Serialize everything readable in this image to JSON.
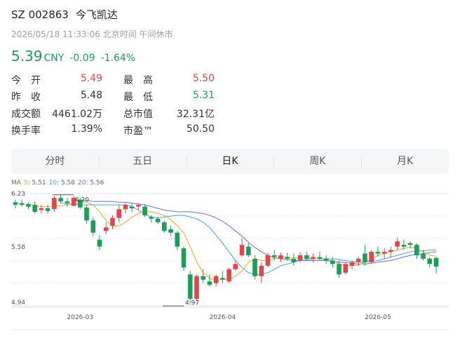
{
  "header": {
    "code": "SZ 002863",
    "name": "今飞凯达",
    "timestamp": "2026/05/18 11:33:06",
    "timezone": "北京时间",
    "status": "午间休市"
  },
  "quote": {
    "price": "5.39",
    "currency": "CNY",
    "change": "-0.09",
    "change_pct": "-1.64%"
  },
  "stats": [
    {
      "label": "今　开",
      "value": "5.49",
      "tone": "up"
    },
    {
      "label": "最　高",
      "value": "5.50",
      "tone": "up"
    },
    {
      "label": "昨　收",
      "value": "5.48",
      "tone": "neutral"
    },
    {
      "label": "最　低",
      "value": "5.31",
      "tone": "down"
    },
    {
      "label": "成交额",
      "value": "4461.02万",
      "tone": "neutral"
    },
    {
      "label": "总市值",
      "value": "32.31亿",
      "tone": "neutral"
    },
    {
      "label": "换手率",
      "value": "1.39%",
      "tone": "neutral"
    },
    {
      "label": "市盈™",
      "value": "50.50",
      "tone": "neutral"
    }
  ],
  "tabs": [
    {
      "label": "分时",
      "active": false
    },
    {
      "label": "五日",
      "active": false
    },
    {
      "label": "日K",
      "active": true
    },
    {
      "label": "周K",
      "active": false
    },
    {
      "label": "月K",
      "active": false
    }
  ],
  "colors": {
    "up": "#e0474c",
    "down": "#1a9f5a",
    "ma5": "#f5a623",
    "ma10": "#4aa3df",
    "ma20": "#6a6fd8"
  },
  "chart_data": {
    "type": "candlestick",
    "ma_legend": [
      {
        "name": "MA",
        "value": ""
      },
      {
        "name": "5",
        "value": "5.51"
      },
      {
        "name": "10",
        "value": "5.58"
      },
      {
        "name": "20",
        "value": "5.56"
      }
    ],
    "y_ticks": [
      "6.23",
      "5.58",
      "4.94"
    ],
    "ylim": [
      4.94,
      6.23
    ],
    "x_ticks": [
      {
        "label": "2026-03",
        "index": 10
      },
      {
        "label": "2026-04",
        "index": 32
      },
      {
        "label": "2026-05",
        "index": 56
      }
    ],
    "annotations": [
      {
        "label": "6.20",
        "index": 9,
        "value": 6.2
      },
      {
        "label": "4.97",
        "index": 26,
        "value": 4.97
      }
    ],
    "candles": [
      [
        6.13,
        6.16,
        6.06,
        6.1
      ],
      [
        6.12,
        6.16,
        6.08,
        6.1
      ],
      [
        6.11,
        6.13,
        6.05,
        6.08
      ],
      [
        6.1,
        6.14,
        6.0,
        6.02
      ],
      [
        6.04,
        6.1,
        6.0,
        6.06
      ],
      [
        6.06,
        6.1,
        6.0,
        6.03
      ],
      [
        6.05,
        6.2,
        6.02,
        6.18
      ],
      [
        6.18,
        6.22,
        6.12,
        6.14
      ],
      [
        6.14,
        6.18,
        6.08,
        6.12
      ],
      [
        6.09,
        6.2,
        6.08,
        6.18
      ],
      [
        6.16,
        6.18,
        6.05,
        6.07
      ],
      [
        6.07,
        6.1,
        5.88,
        5.92
      ],
      [
        5.92,
        5.96,
        5.74,
        5.78
      ],
      [
        5.7,
        5.75,
        5.58,
        5.62
      ],
      [
        5.8,
        5.9,
        5.76,
        5.84
      ],
      [
        5.86,
        5.98,
        5.82,
        5.95
      ],
      [
        5.95,
        6.1,
        5.9,
        6.05
      ],
      [
        6.05,
        6.12,
        6.0,
        6.1
      ],
      [
        6.08,
        6.12,
        6.02,
        6.06
      ],
      [
        6.08,
        6.12,
        6.04,
        6.1
      ],
      [
        6.08,
        6.1,
        5.96,
        5.98
      ],
      [
        5.96,
        5.98,
        5.9,
        5.94
      ],
      [
        5.94,
        5.96,
        5.88,
        5.9
      ],
      [
        5.9,
        5.92,
        5.78,
        5.8
      ],
      [
        5.82,
        5.86,
        5.74,
        5.78
      ],
      [
        5.78,
        5.8,
        5.58,
        5.62
      ],
      [
        5.6,
        5.62,
        5.34,
        5.38
      ],
      [
        5.3,
        5.34,
        4.97,
        5.02
      ],
      [
        5.02,
        5.3,
        5.0,
        5.28
      ],
      [
        5.28,
        5.36,
        5.2,
        5.24
      ],
      [
        5.22,
        5.3,
        5.16,
        5.18
      ],
      [
        5.2,
        5.3,
        5.16,
        5.28
      ],
      [
        5.26,
        5.34,
        5.2,
        5.24
      ],
      [
        5.22,
        5.38,
        5.2,
        5.36
      ],
      [
        5.36,
        5.46,
        5.34,
        5.42
      ],
      [
        5.52,
        5.72,
        5.5,
        5.64
      ],
      [
        5.62,
        5.66,
        5.5,
        5.52
      ],
      [
        5.48,
        5.52,
        5.24,
        5.28
      ],
      [
        5.28,
        5.44,
        5.2,
        5.4
      ],
      [
        5.4,
        5.55,
        5.38,
        5.52
      ],
      [
        5.52,
        5.58,
        5.46,
        5.5
      ],
      [
        5.48,
        5.55,
        5.44,
        5.52
      ],
      [
        5.5,
        5.55,
        5.46,
        5.48
      ],
      [
        5.48,
        5.54,
        5.4,
        5.44
      ],
      [
        5.46,
        5.56,
        5.44,
        5.52
      ],
      [
        5.52,
        5.56,
        5.46,
        5.48
      ],
      [
        5.48,
        5.54,
        5.44,
        5.5
      ],
      [
        5.5,
        5.56,
        5.46,
        5.48
      ],
      [
        5.48,
        5.52,
        5.42,
        5.46
      ],
      [
        5.46,
        5.5,
        5.38,
        5.42
      ],
      [
        5.42,
        5.46,
        5.26,
        5.3
      ],
      [
        5.32,
        5.44,
        5.3,
        5.42
      ],
      [
        5.4,
        5.46,
        5.36,
        5.44
      ],
      [
        5.44,
        5.5,
        5.4,
        5.48
      ],
      [
        5.54,
        5.64,
        5.4,
        5.44
      ],
      [
        5.44,
        5.58,
        5.42,
        5.56
      ],
      [
        5.56,
        5.62,
        5.5,
        5.54
      ],
      [
        5.54,
        5.6,
        5.48,
        5.56
      ],
      [
        5.56,
        5.62,
        5.5,
        5.58
      ],
      [
        5.62,
        5.72,
        5.58,
        5.68
      ],
      [
        5.64,
        5.7,
        5.58,
        5.62
      ],
      [
        5.66,
        5.68,
        5.6,
        5.64
      ],
      [
        5.64,
        5.66,
        5.48,
        5.52
      ],
      [
        5.54,
        5.58,
        5.46,
        5.48
      ],
      [
        5.48,
        5.5,
        5.38,
        5.42
      ],
      [
        5.49,
        5.5,
        5.31,
        5.39
      ]
    ],
    "ma5": [
      6.1,
      6.09,
      6.08,
      6.08,
      6.08,
      6.09,
      6.1,
      6.11,
      6.12,
      6.13,
      6.1,
      6.02,
      5.92,
      5.85,
      5.86,
      5.9,
      5.96,
      6.0,
      6.03,
      6.02,
      6.0,
      5.98,
      5.93,
      5.86,
      5.78,
      5.62,
      5.44,
      5.32,
      5.26,
      5.22,
      5.25,
      5.24,
      5.28,
      5.34,
      5.44,
      5.48,
      5.46,
      5.46,
      5.48,
      5.5,
      5.5,
      5.49,
      5.49,
      5.49,
      5.48,
      5.48,
      5.47,
      5.46,
      5.42,
      5.4,
      5.4,
      5.41,
      5.44,
      5.48,
      5.52,
      5.54,
      5.56,
      5.58,
      5.6,
      5.61,
      5.6,
      5.56,
      5.52,
      5.51
    ],
    "ma10": [
      6.12,
      6.11,
      6.11,
      6.1,
      6.1,
      6.1,
      6.1,
      6.1,
      6.1,
      6.1,
      6.1,
      6.08,
      6.04,
      5.99,
      5.96,
      5.95,
      5.96,
      5.97,
      5.98,
      5.98,
      5.96,
      5.94,
      5.9,
      5.84,
      5.75,
      5.66,
      5.56,
      5.46,
      5.38,
      5.32,
      5.3,
      5.3,
      5.32,
      5.36,
      5.4,
      5.42,
      5.44,
      5.46,
      5.47,
      5.48,
      5.48,
      5.48,
      5.48,
      5.47,
      5.46,
      5.45,
      5.44,
      5.44,
      5.45,
      5.46,
      5.48,
      5.5,
      5.52,
      5.54,
      5.56,
      5.57,
      5.57,
      5.58,
      5.58
    ],
    "ma20": [
      6.15,
      6.15,
      6.15,
      6.14,
      6.14,
      6.14,
      6.14,
      6.13,
      6.13,
      6.12,
      6.11,
      6.1,
      6.08,
      6.06,
      6.04,
      6.03,
      6.02,
      6.02,
      6.02,
      6.01,
      6.0,
      5.98,
      5.95,
      5.91,
      5.86,
      5.8,
      5.74,
      5.67,
      5.61,
      5.56,
      5.52,
      5.49,
      5.48,
      5.47,
      5.46,
      5.46,
      5.46,
      5.46,
      5.46,
      5.46,
      5.45,
      5.44,
      5.44,
      5.43,
      5.42,
      5.42,
      5.43,
      5.44,
      5.45,
      5.46,
      5.48,
      5.5,
      5.52,
      5.53,
      5.54,
      5.55,
      5.56
    ]
  }
}
